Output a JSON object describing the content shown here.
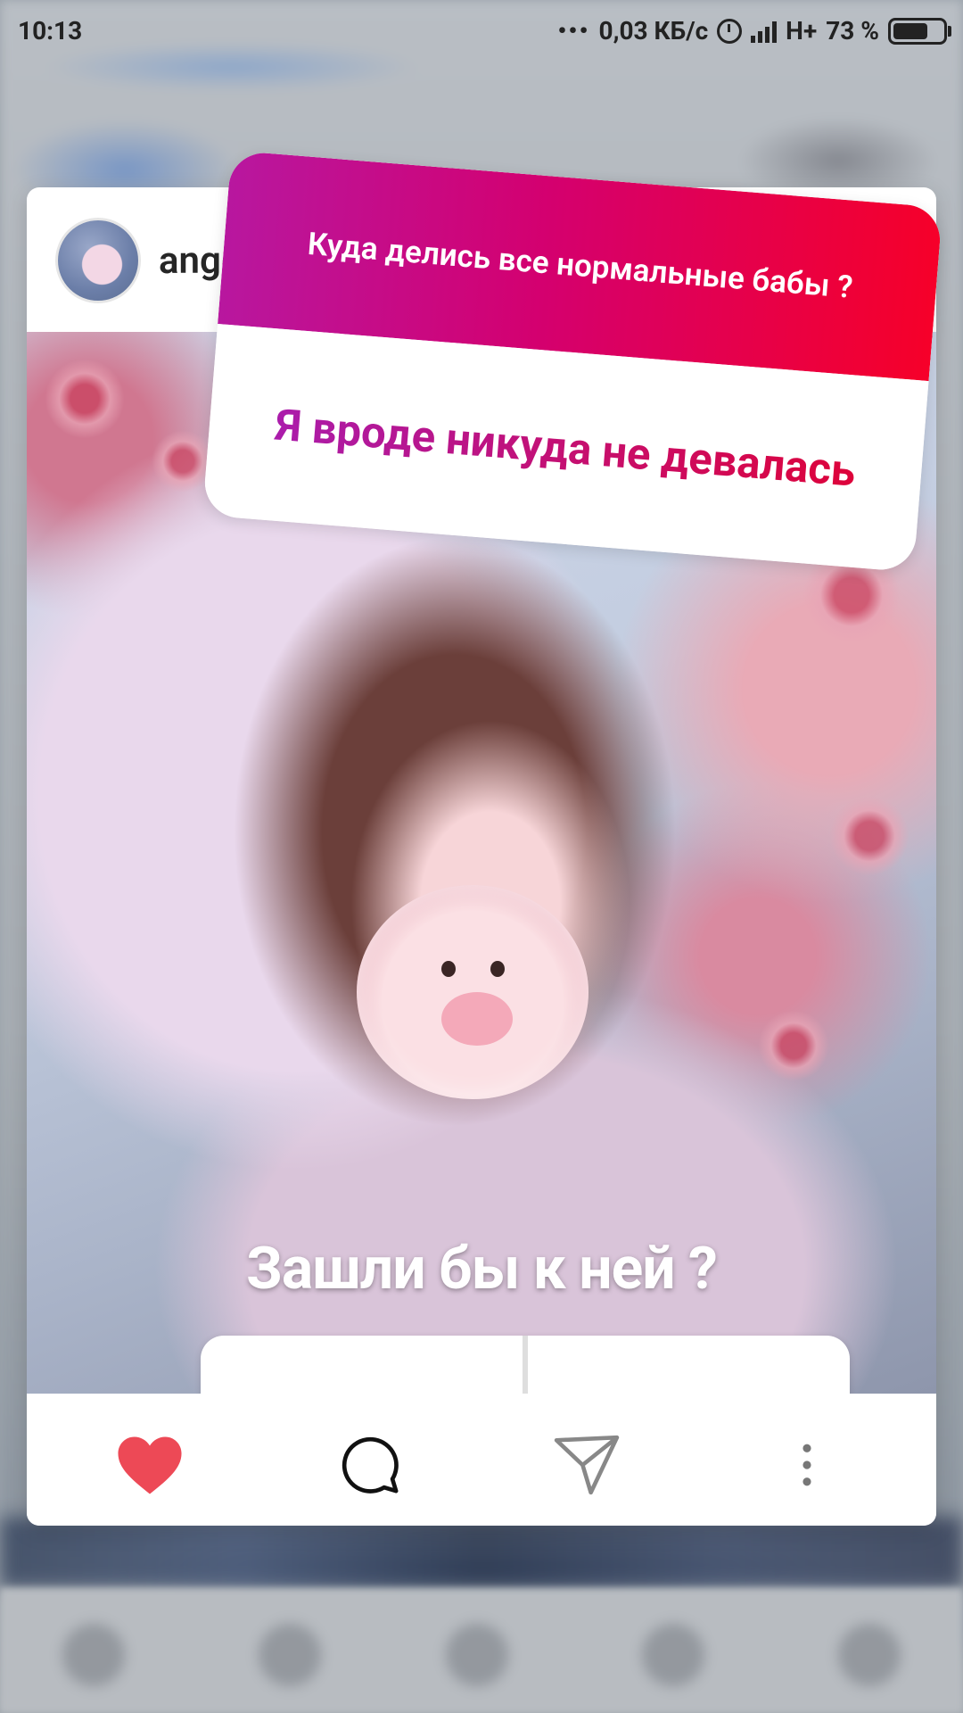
{
  "status_bar": {
    "time": "10:13",
    "more": "•••",
    "speed": "0,03 КБ/с",
    "network": "H+",
    "battery": "73 %"
  },
  "post": {
    "username": "ange"
  },
  "question_sticker": {
    "question": "Куда делись все нормальные бабы ?",
    "answer": "Я вроде никуда не девалась"
  },
  "story_text": "Зашли бы к ней ?",
  "poll": {
    "option_yes": "+",
    "option_no": "-"
  },
  "actions": {
    "like_icon": "heart-icon",
    "comment_icon": "comment-icon",
    "share_icon": "send-icon",
    "more_icon": "more-vertical-icon"
  },
  "colors": {
    "gradient_start": "#b8179f",
    "gradient_end": "#f60029",
    "poll_yes": "#1fc29a",
    "poll_no": "#f0577a",
    "like": "#ed4956"
  }
}
